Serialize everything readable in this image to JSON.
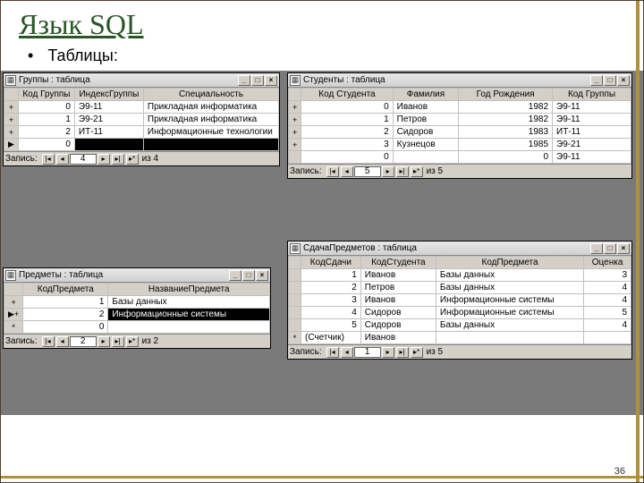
{
  "slide": {
    "title": "Язык SQL",
    "bullet": "Таблицы:",
    "page": "36"
  },
  "nav": {
    "label": "Запись:",
    "first": "|◂",
    "prev": "◂",
    "next": "▸",
    "last": "▸|",
    "new": "▸*"
  },
  "tb": {
    "min": "_",
    "max": "□",
    "close": "×"
  },
  "win_groups": {
    "title": "Группы : таблица",
    "cols": [
      "Код Группы",
      "ИндексГруппы",
      "Специальность"
    ],
    "rows": [
      {
        "sel": "+",
        "c": [
          "0",
          "Э9-11",
          "Прикладная информатика"
        ]
      },
      {
        "sel": "+",
        "c": [
          "1",
          "Э9-21",
          "Прикладная информатика"
        ]
      },
      {
        "sel": "+",
        "c": [
          "2",
          "ИТ-11",
          "Информационные технологии"
        ]
      },
      {
        "sel": "▶",
        "c": [
          "0",
          "",
          ""
        ],
        "cur": true
      }
    ],
    "pos": "4",
    "of": "из 4"
  },
  "win_students": {
    "title": "Студенты : таблица",
    "cols": [
      "Код Студента",
      "Фамилия",
      "Год Рождения",
      "Код Группы"
    ],
    "rows": [
      {
        "sel": "+",
        "c": [
          "0",
          "Иванов",
          "1982",
          "Э9-11"
        ]
      },
      {
        "sel": "+",
        "c": [
          "1",
          "Петров",
          "1982",
          "Э9-11"
        ]
      },
      {
        "sel": "+",
        "c": [
          "2",
          "Сидоров",
          "1983",
          "ИТ-11"
        ]
      },
      {
        "sel": "+",
        "c": [
          "3",
          "Кузнецов",
          "1985",
          "Э9-21"
        ]
      },
      {
        "sel": "",
        "c": [
          "0",
          "",
          "0",
          "Э9-11"
        ]
      }
    ],
    "pos": "5",
    "of": "из 5"
  },
  "win_subjects": {
    "title": "Предметы : таблица",
    "cols": [
      "КодПредмета",
      "НазваниеПредмета"
    ],
    "rows": [
      {
        "sel": "+",
        "c": [
          "1",
          "Базы данных"
        ]
      },
      {
        "sel": "▶+",
        "c": [
          "2",
          "Информационные системы"
        ],
        "cur2": true
      },
      {
        "sel": "*",
        "c": [
          "0",
          ""
        ]
      }
    ],
    "pos": "2",
    "of": "из 2"
  },
  "win_exams": {
    "title": "СдачаПредметов : таблица",
    "cols": [
      "КодСдачи",
      "КодСтудента",
      "КодПредмета",
      "Оценка"
    ],
    "rows": [
      {
        "sel": "",
        "c": [
          "1",
          "Иванов",
          "Базы данных",
          "3"
        ]
      },
      {
        "sel": "",
        "c": [
          "2",
          "Петров",
          "Базы данных",
          "4"
        ]
      },
      {
        "sel": "",
        "c": [
          "3",
          "Иванов",
          "Информационные системы",
          "4"
        ]
      },
      {
        "sel": "",
        "c": [
          "4",
          "Сидоров",
          "Информационные системы",
          "5"
        ]
      },
      {
        "sel": "",
        "c": [
          "5",
          "Сидоров",
          "Базы данных",
          "4"
        ]
      },
      {
        "sel": "*",
        "c": [
          "(Счетчик)",
          "Иванов",
          "",
          ""
        ]
      }
    ],
    "pos": "1",
    "of": "из 5"
  }
}
